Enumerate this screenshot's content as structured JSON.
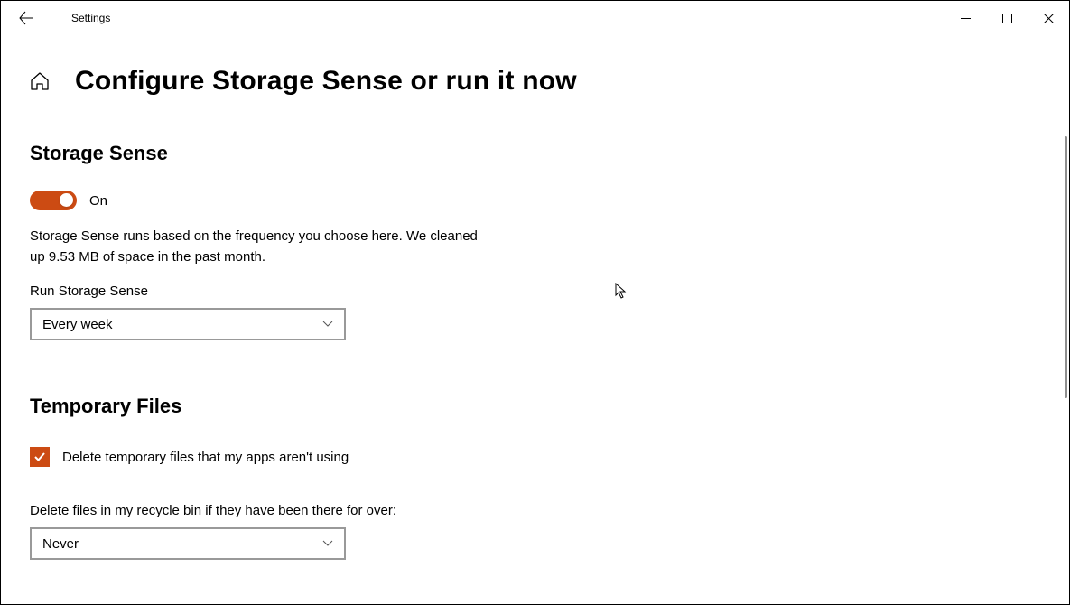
{
  "window": {
    "title": "Settings"
  },
  "page": {
    "title": "Configure Storage Sense or run it now"
  },
  "storage_sense": {
    "heading": "Storage Sense",
    "toggle_state": "On",
    "description": "Storage Sense runs based on the frequency you choose here. We cleaned up 9.53 MB of space in the past month.",
    "run_label": "Run Storage Sense",
    "run_dropdown_value": "Every week"
  },
  "temp_files": {
    "heading": "Temporary Files",
    "delete_temp_checkbox_label": "Delete temporary files that my apps aren't using",
    "recycle_label": "Delete files in my recycle bin if they have been there for over:",
    "recycle_dropdown_value": "Never"
  }
}
